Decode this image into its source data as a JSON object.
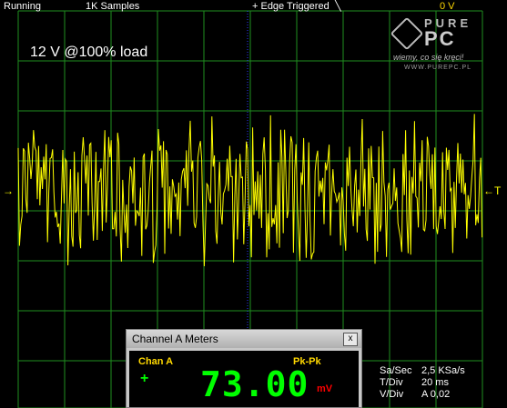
{
  "status_bar": {
    "state": "Running",
    "samples": "1K Samples",
    "trigger": "+ Edge Triggered",
    "trigger_level": "0 V"
  },
  "scope": {
    "annotation": "12 V @100% load",
    "colors": {
      "background": "#000000",
      "grid": "#1f8f1f",
      "trace": "#ffff00",
      "center_line": "#2e3cff"
    }
  },
  "logo": {
    "line1": "PURE",
    "line2": "PC",
    "tagline": "wiemy, co się kręci!",
    "url": "WWW.PUREPC.PL"
  },
  "meter_window": {
    "title": "Channel A Meters",
    "close_label": "x",
    "channel_label": "Chan A",
    "measurement": "Pk-Pk",
    "sign": "+",
    "value": "73.00",
    "unit": "mV",
    "colors": {
      "digits": "#00ff00",
      "label": "#ffd800",
      "unit": "#ff0000"
    }
  },
  "settings": {
    "sa_sec_label": "Sa/Sec",
    "sa_sec_value": "2,5 KSa/s",
    "t_div_label": "T/Div",
    "t_div_value": "20 ms",
    "v_div_label": "V/Div",
    "v_div_value": "A 0,02"
  }
}
